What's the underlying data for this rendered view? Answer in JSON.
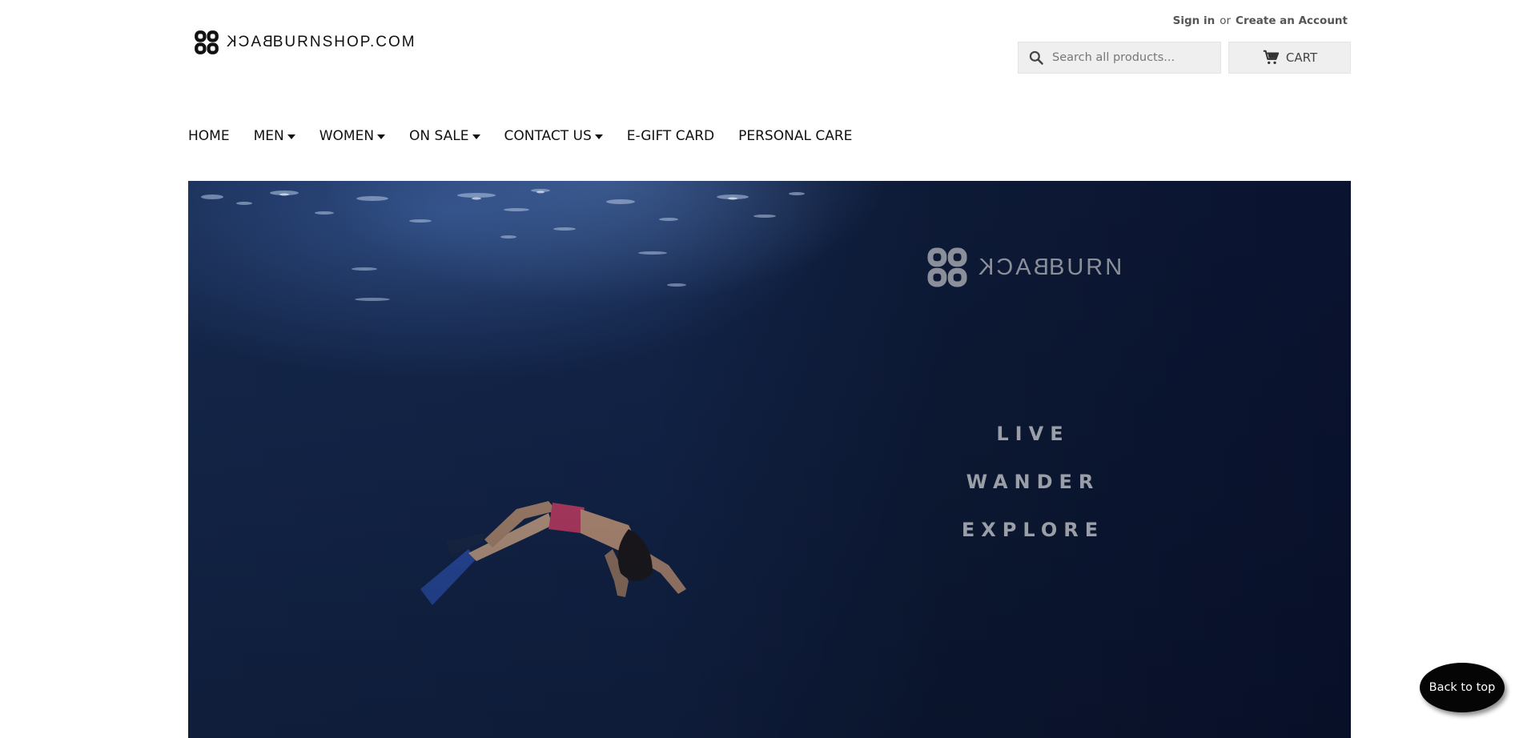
{
  "header": {
    "logo_text_mirrored": "BACK",
    "logo_text_rest": "BURNSHOP.COM",
    "sign_in": "Sign in",
    "or": "or",
    "create_account": "Create an Account",
    "search_placeholder": "Search all products...",
    "cart_label": "CART"
  },
  "nav": {
    "items": [
      {
        "label": "HOME",
        "has_dropdown": false
      },
      {
        "label": "MEN",
        "has_dropdown": true
      },
      {
        "label": "WOMEN",
        "has_dropdown": true
      },
      {
        "label": "ON SALE",
        "has_dropdown": true
      },
      {
        "label": "CONTACT US",
        "has_dropdown": true
      },
      {
        "label": "E-GIFT CARD",
        "has_dropdown": false
      },
      {
        "label": "PERSONAL CARE",
        "has_dropdown": false
      }
    ]
  },
  "hero": {
    "logo_text_mirrored": "BACK",
    "logo_text_rest": "BURN",
    "tagline": [
      "LIVE",
      "WANDER",
      "EXPLORE"
    ]
  },
  "back_to_top": "Back to top",
  "colors": {
    "hero_dark": "#0d1a36",
    "hero_text": "#9a9ea6",
    "button_bg": "#efefef"
  }
}
